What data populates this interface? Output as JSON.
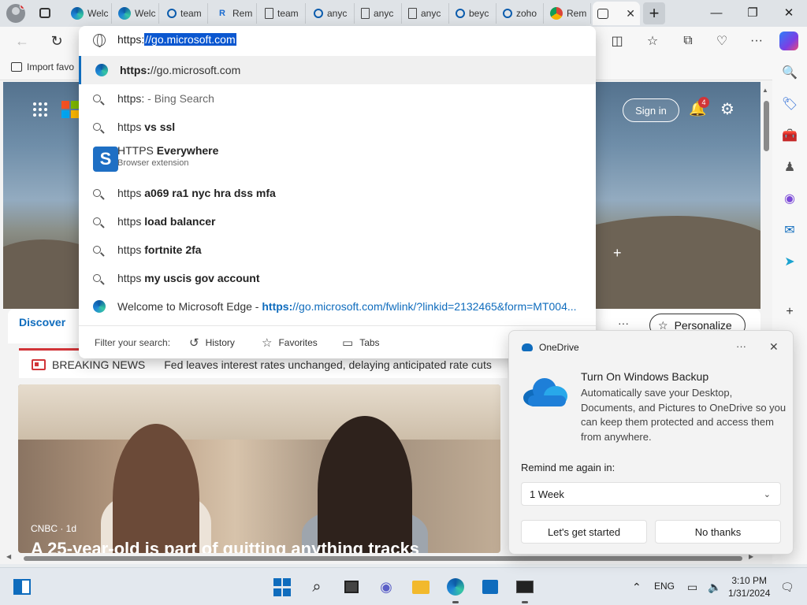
{
  "window": {
    "tabs": [
      {
        "label": "Welc",
        "icon": "edge-icon"
      },
      {
        "label": "Welc",
        "icon": "edge-icon"
      },
      {
        "label": "team",
        "icon": "search-icon"
      },
      {
        "label": "Rem",
        "icon": "remote-desktop-icon"
      },
      {
        "label": "team",
        "icon": "document-icon"
      },
      {
        "label": "anyc",
        "icon": "search-icon"
      },
      {
        "label": "anyc",
        "icon": "document-icon"
      },
      {
        "label": "anyc",
        "icon": "document-icon"
      },
      {
        "label": "beyc",
        "icon": "search-icon"
      },
      {
        "label": "zoho",
        "icon": "search-icon"
      },
      {
        "label": "Rem",
        "icon": "chrome-icon"
      }
    ],
    "new_tab_label": "+",
    "minimize": "—",
    "maximize": "❐",
    "close": "✕"
  },
  "toolbar": {
    "back": "←",
    "refresh": "↻"
  },
  "favorites_bar": {
    "import_label": "Import favo"
  },
  "omnibox": {
    "input_prefix": "https:",
    "input_selected": "//go.microsoft.com",
    "suggestions": [
      {
        "kind": "url",
        "bold": "https:",
        "text": "//go.microsoft.com"
      },
      {
        "kind": "search",
        "plain": "https:",
        "muted": " - Bing Search"
      },
      {
        "kind": "search",
        "plain": "https ",
        "bold": "vs ssl"
      },
      {
        "kind": "extension",
        "bold_prefix": "HTTPS",
        "bold": " Everywhere",
        "sub": "Browser extension"
      },
      {
        "kind": "search",
        "plain": "https ",
        "bold": "a069 ra1 nyc hra dss mfa"
      },
      {
        "kind": "search",
        "plain": "https ",
        "bold": "load balancer"
      },
      {
        "kind": "search",
        "plain": "https ",
        "bold": "fortnite 2fa"
      },
      {
        "kind": "search",
        "plain": "https ",
        "bold": "my uscis gov account"
      },
      {
        "kind": "history",
        "plain": "Welcome to Microsoft Edge - ",
        "url_bold": "https:",
        "url": "//go.microsoft.com/fwlink/?linkid=2132465&form=MT004..."
      }
    ],
    "filter": {
      "label": "Filter your search:",
      "history": "History",
      "favorites": "Favorites",
      "tabs": "Tabs"
    }
  },
  "newtab": {
    "sign_in": "Sign in",
    "notification_count": "4",
    "discover_tab": "Discover",
    "more": "···",
    "personalize": "Personalize",
    "breaking_label": "BREAKING NEWS",
    "breaking_text": "Fed leaves interest rates unchanged, delaying anticipated rate cuts",
    "article_source": "CNBC · 1d",
    "article_headline": "A 25-year-old is part of quitting anything tracks"
  },
  "toast": {
    "app_name": "OneDrive",
    "more": "···",
    "close": "✕",
    "title": "Turn On Windows Backup",
    "body": "Automatically save your Desktop, Documents, and Pictures to OneDrive so you can keep them protected and access them from anywhere.",
    "remind_label": "Remind me again in:",
    "remind_value": "1 Week",
    "primary_button": "Let's get started",
    "secondary_button": "No thanks"
  },
  "taskbar": {
    "language": "ENG",
    "time": "3:10 PM",
    "date": "1/31/2024"
  }
}
